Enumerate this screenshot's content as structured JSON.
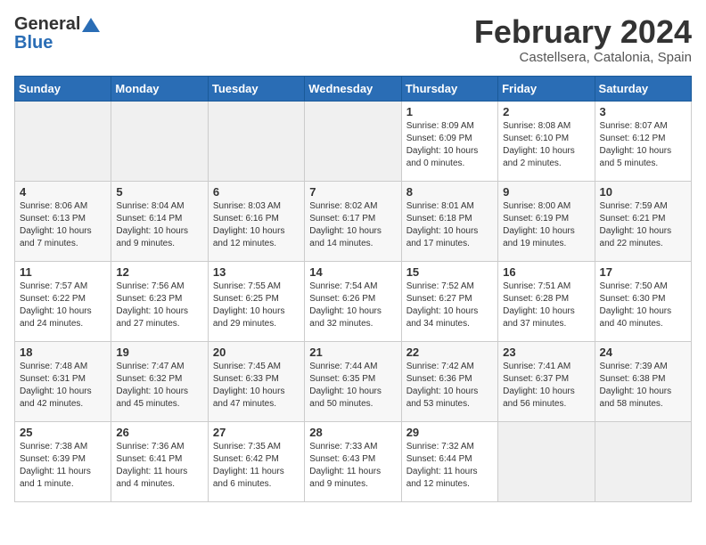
{
  "logo": {
    "general": "General",
    "blue": "Blue"
  },
  "title": {
    "month_year": "February 2024",
    "location": "Castellsera, Catalonia, Spain"
  },
  "headers": [
    "Sunday",
    "Monday",
    "Tuesday",
    "Wednesday",
    "Thursday",
    "Friday",
    "Saturday"
  ],
  "weeks": [
    [
      {
        "day": "",
        "details": ""
      },
      {
        "day": "",
        "details": ""
      },
      {
        "day": "",
        "details": ""
      },
      {
        "day": "",
        "details": ""
      },
      {
        "day": "1",
        "details": "Sunrise: 8:09 AM\nSunset: 6:09 PM\nDaylight: 10 hours\nand 0 minutes."
      },
      {
        "day": "2",
        "details": "Sunrise: 8:08 AM\nSunset: 6:10 PM\nDaylight: 10 hours\nand 2 minutes."
      },
      {
        "day": "3",
        "details": "Sunrise: 8:07 AM\nSunset: 6:12 PM\nDaylight: 10 hours\nand 5 minutes."
      }
    ],
    [
      {
        "day": "4",
        "details": "Sunrise: 8:06 AM\nSunset: 6:13 PM\nDaylight: 10 hours\nand 7 minutes."
      },
      {
        "day": "5",
        "details": "Sunrise: 8:04 AM\nSunset: 6:14 PM\nDaylight: 10 hours\nand 9 minutes."
      },
      {
        "day": "6",
        "details": "Sunrise: 8:03 AM\nSunset: 6:16 PM\nDaylight: 10 hours\nand 12 minutes."
      },
      {
        "day": "7",
        "details": "Sunrise: 8:02 AM\nSunset: 6:17 PM\nDaylight: 10 hours\nand 14 minutes."
      },
      {
        "day": "8",
        "details": "Sunrise: 8:01 AM\nSunset: 6:18 PM\nDaylight: 10 hours\nand 17 minutes."
      },
      {
        "day": "9",
        "details": "Sunrise: 8:00 AM\nSunset: 6:19 PM\nDaylight: 10 hours\nand 19 minutes."
      },
      {
        "day": "10",
        "details": "Sunrise: 7:59 AM\nSunset: 6:21 PM\nDaylight: 10 hours\nand 22 minutes."
      }
    ],
    [
      {
        "day": "11",
        "details": "Sunrise: 7:57 AM\nSunset: 6:22 PM\nDaylight: 10 hours\nand 24 minutes."
      },
      {
        "day": "12",
        "details": "Sunrise: 7:56 AM\nSunset: 6:23 PM\nDaylight: 10 hours\nand 27 minutes."
      },
      {
        "day": "13",
        "details": "Sunrise: 7:55 AM\nSunset: 6:25 PM\nDaylight: 10 hours\nand 29 minutes."
      },
      {
        "day": "14",
        "details": "Sunrise: 7:54 AM\nSunset: 6:26 PM\nDaylight: 10 hours\nand 32 minutes."
      },
      {
        "day": "15",
        "details": "Sunrise: 7:52 AM\nSunset: 6:27 PM\nDaylight: 10 hours\nand 34 minutes."
      },
      {
        "day": "16",
        "details": "Sunrise: 7:51 AM\nSunset: 6:28 PM\nDaylight: 10 hours\nand 37 minutes."
      },
      {
        "day": "17",
        "details": "Sunrise: 7:50 AM\nSunset: 6:30 PM\nDaylight: 10 hours\nand 40 minutes."
      }
    ],
    [
      {
        "day": "18",
        "details": "Sunrise: 7:48 AM\nSunset: 6:31 PM\nDaylight: 10 hours\nand 42 minutes."
      },
      {
        "day": "19",
        "details": "Sunrise: 7:47 AM\nSunset: 6:32 PM\nDaylight: 10 hours\nand 45 minutes."
      },
      {
        "day": "20",
        "details": "Sunrise: 7:45 AM\nSunset: 6:33 PM\nDaylight: 10 hours\nand 47 minutes."
      },
      {
        "day": "21",
        "details": "Sunrise: 7:44 AM\nSunset: 6:35 PM\nDaylight: 10 hours\nand 50 minutes."
      },
      {
        "day": "22",
        "details": "Sunrise: 7:42 AM\nSunset: 6:36 PM\nDaylight: 10 hours\nand 53 minutes."
      },
      {
        "day": "23",
        "details": "Sunrise: 7:41 AM\nSunset: 6:37 PM\nDaylight: 10 hours\nand 56 minutes."
      },
      {
        "day": "24",
        "details": "Sunrise: 7:39 AM\nSunset: 6:38 PM\nDaylight: 10 hours\nand 58 minutes."
      }
    ],
    [
      {
        "day": "25",
        "details": "Sunrise: 7:38 AM\nSunset: 6:39 PM\nDaylight: 11 hours\nand 1 minute."
      },
      {
        "day": "26",
        "details": "Sunrise: 7:36 AM\nSunset: 6:41 PM\nDaylight: 11 hours\nand 4 minutes."
      },
      {
        "day": "27",
        "details": "Sunrise: 7:35 AM\nSunset: 6:42 PM\nDaylight: 11 hours\nand 6 minutes."
      },
      {
        "day": "28",
        "details": "Sunrise: 7:33 AM\nSunset: 6:43 PM\nDaylight: 11 hours\nand 9 minutes."
      },
      {
        "day": "29",
        "details": "Sunrise: 7:32 AM\nSunset: 6:44 PM\nDaylight: 11 hours\nand 12 minutes."
      },
      {
        "day": "",
        "details": ""
      },
      {
        "day": "",
        "details": ""
      }
    ]
  ]
}
